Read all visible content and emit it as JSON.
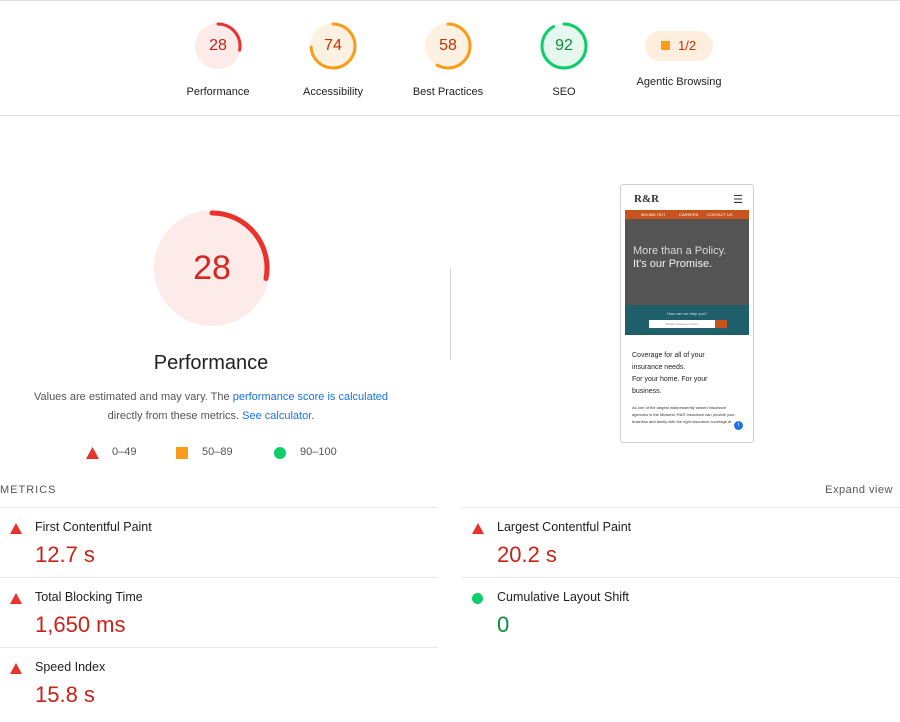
{
  "summary": {
    "categories": [
      {
        "label": "Performance",
        "score": "28",
        "status": "fail"
      },
      {
        "label": "Accessibility",
        "score": "74",
        "status": "average"
      },
      {
        "label": "Best Practices",
        "score": "58",
        "status": "average"
      },
      {
        "label": "SEO",
        "score": "92",
        "status": "pass"
      }
    ],
    "agentic": {
      "label": "Agentic Browsing",
      "fraction": "1/2"
    }
  },
  "performance": {
    "score": "28",
    "title": "Performance",
    "desc_pre": "Values are estimated and may vary. The ",
    "desc_link1": "performance score is calculated",
    "desc_mid": " directly from these metrics. ",
    "desc_link2": "See calculator",
    "desc_end": "."
  },
  "legend": [
    {
      "range": "0–49",
      "icon": "triangle-icon"
    },
    {
      "range": "50–89",
      "icon": "square-icon"
    },
    {
      "range": "90–100",
      "icon": "circle-icon"
    }
  ],
  "screenshot": {
    "logo": "R&R",
    "nav": [
      "800.555.7917",
      "CAREERS",
      "CONTACT US"
    ],
    "hero_line1": "More than a Policy.",
    "hero_line2": "It's our Promise.",
    "help_question": "How can we help you?",
    "select_placeholder": "Please choose an option",
    "copy_lines": [
      "Coverage for all of your",
      "insurance needs.",
      "For your home. For your",
      "business."
    ],
    "small_copy": "As one of the largest independently owned insurance agencies in the Midwest, R&R Insurance can provide your business and family with the right insurance coverage at",
    "badge": "i"
  },
  "metrics": {
    "heading": "METRICS",
    "expand": "Expand view",
    "items": [
      {
        "label": "First Contentful Paint",
        "value": "12.7 s",
        "status": "fail"
      },
      {
        "label": "Largest Contentful Paint",
        "value": "20.2 s",
        "status": "fail"
      },
      {
        "label": "Total Blocking Time",
        "value": "1,650 ms",
        "status": "fail"
      },
      {
        "label": "Cumulative Layout Shift",
        "value": "0",
        "status": "pass"
      },
      {
        "label": "Speed Index",
        "value": "15.8 s",
        "status": "fail"
      }
    ]
  },
  "colors": {
    "fail": "#e8322b",
    "average": "#fa9c17",
    "pass": "#0cce6b"
  }
}
